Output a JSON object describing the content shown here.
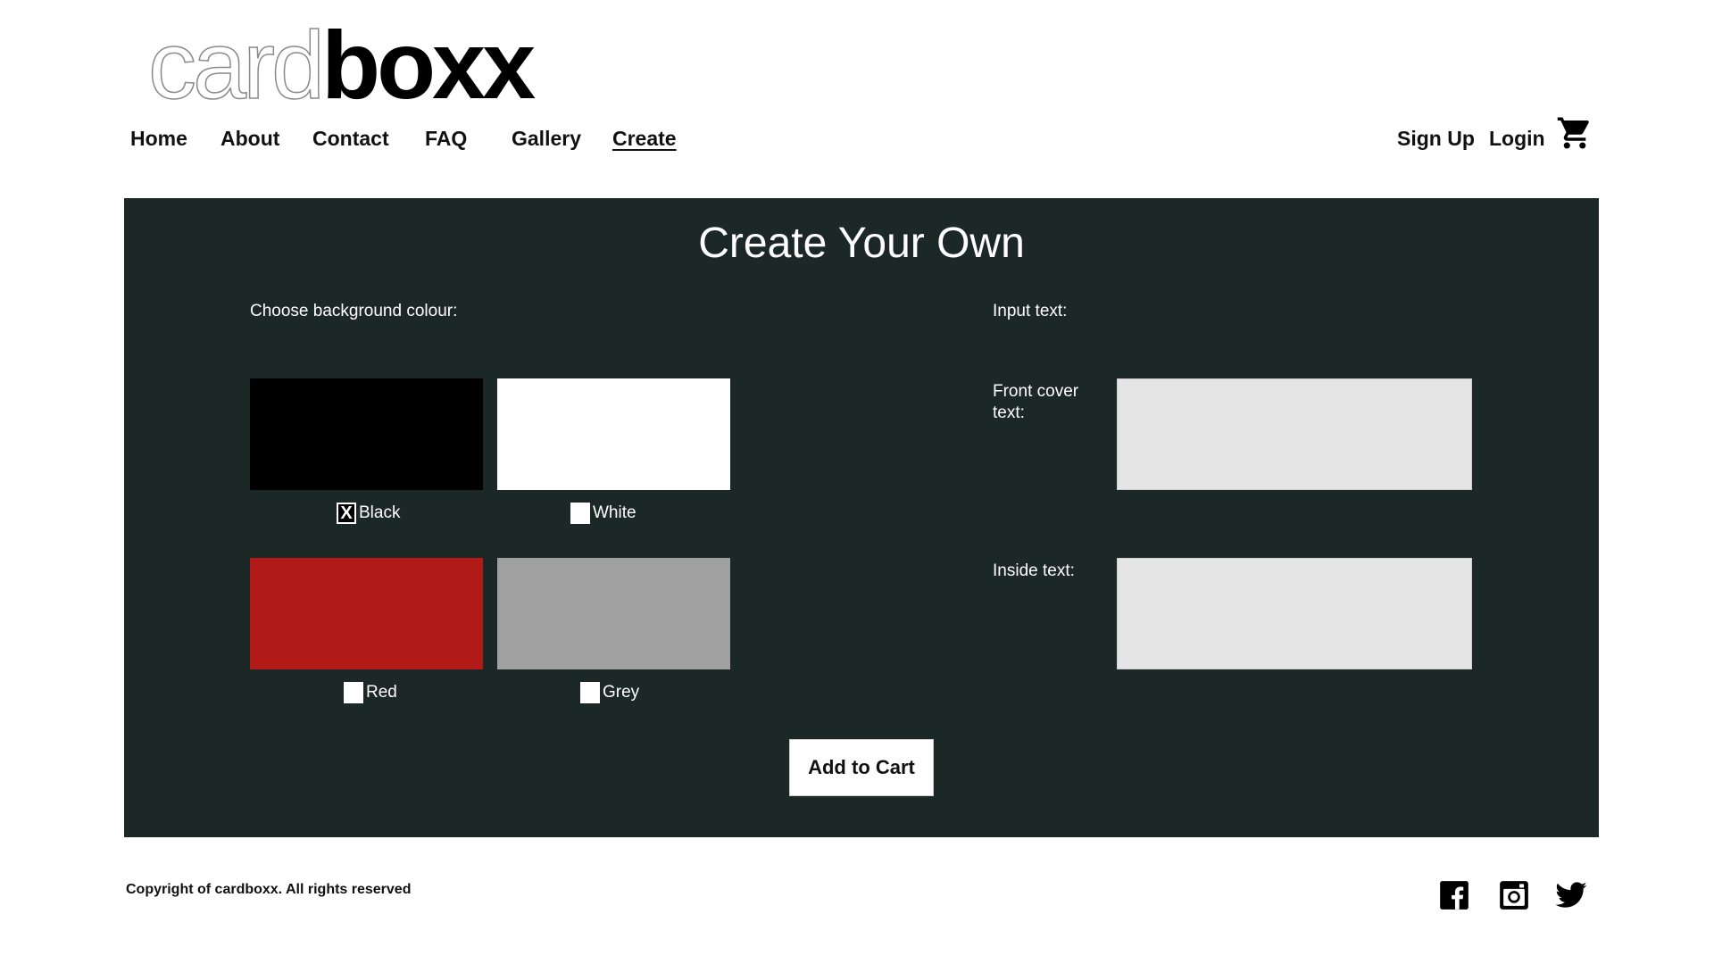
{
  "logo": {
    "light_text": "card",
    "bold_text": "boxx"
  },
  "nav": {
    "items": [
      {
        "label": "Home"
      },
      {
        "label": "About"
      },
      {
        "label": "Contact"
      },
      {
        "label": "FAQ"
      },
      {
        "label": "Gallery"
      },
      {
        "label": "Create",
        "active": true
      }
    ],
    "sign_up": "Sign Up",
    "login": "Login",
    "cart_icon": "shopping-cart-icon"
  },
  "create": {
    "title": "Create Your Own",
    "background_label": "Choose background colour:",
    "colours": [
      {
        "name": "Black",
        "hex": "#000000",
        "checked": true
      },
      {
        "name": "White",
        "hex": "#ffffff",
        "checked": false
      },
      {
        "name": "Red",
        "hex": "#b21a17",
        "checked": false
      },
      {
        "name": "Grey",
        "hex": "#a0a0a0",
        "checked": false
      }
    ],
    "checked_mark": "X",
    "input_label": "Input text:",
    "front_cover_label": "Front cover text:",
    "front_cover_value": "",
    "inside_label": "Inside text:",
    "inside_value": "",
    "add_to_cart": "Add to Cart"
  },
  "footer": {
    "copyright": "Copyright of cardboxx. All rights reserved",
    "social_icons": [
      "facebook-icon",
      "instagram-icon",
      "twitter-icon"
    ]
  },
  "colors": {
    "panel_bg": "#1c2826",
    "input_bg": "#e5e5e5"
  }
}
